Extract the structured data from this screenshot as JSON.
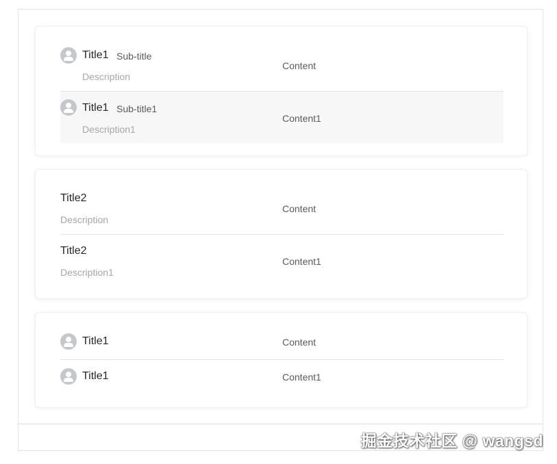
{
  "cards": [
    {
      "rows": [
        {
          "title": "Title1",
          "subtitle": "Sub-title",
          "description": "Description",
          "content": "Content",
          "has_avatar": true,
          "highlighted": false
        },
        {
          "title": "Title1",
          "subtitle": "Sub-title1",
          "description": "Description1",
          "content": "Content1",
          "has_avatar": true,
          "highlighted": true
        }
      ]
    },
    {
      "rows": [
        {
          "title": "Title2",
          "description": "Description",
          "content": "Content",
          "has_avatar": false
        },
        {
          "title": "Title2",
          "description": "Description1",
          "content": "Content1",
          "has_avatar": false
        }
      ]
    },
    {
      "rows": [
        {
          "title": "Title1",
          "content": "Content",
          "has_avatar": true
        },
        {
          "title": "Title1",
          "content": "Content1",
          "has_avatar": true
        }
      ]
    }
  ],
  "watermark": "掘金技术社区 @ wangsd",
  "colors": {
    "avatar": "#c4c7cc",
    "highlight_bg": "#f7f7f7",
    "divider": "#e3e3e3",
    "description": "#a6a6a6"
  },
  "icons": {
    "avatar": "user-avatar-icon"
  }
}
